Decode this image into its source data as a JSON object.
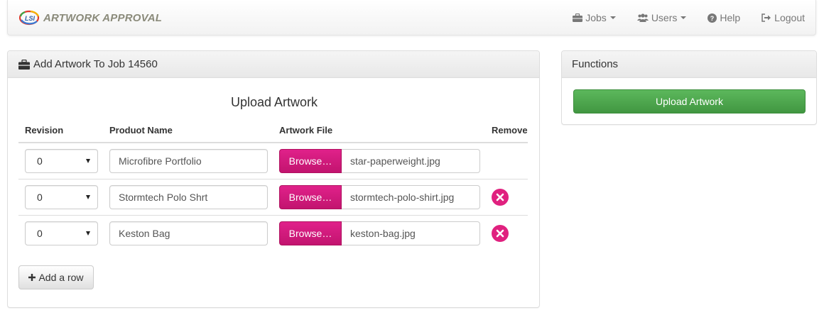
{
  "brand": {
    "name": "ARTWORK APPROVAL",
    "logo_icon": "lsi-logo-icon"
  },
  "nav": {
    "jobs": "Jobs",
    "users": "Users",
    "help": "Help",
    "logout": "Logout"
  },
  "main_panel": {
    "heading": "Add Artwork To Job 14560",
    "heading_icon": "briefcase-icon",
    "upload_title": "Upload Artwork",
    "columns": {
      "revision": "Revision",
      "product_name": "Produot Name",
      "artwork_file": "Artwork File",
      "remove": "Remove"
    },
    "rows": [
      {
        "revision": "0",
        "product_name": "Microfibre Portfolio",
        "browse_label": "Browse…",
        "file": "star-paperweight.jpg",
        "removable": false
      },
      {
        "revision": "0",
        "product_name": "Stormtech Polo Shrt",
        "browse_label": "Browse…",
        "file": "stormtech-polo-shirt.jpg",
        "removable": true
      },
      {
        "revision": "0",
        "product_name": "Keston Bag",
        "browse_label": "Browse…",
        "file": "keston-bag.jpg",
        "removable": true
      }
    ],
    "add_row_label": "Add a row"
  },
  "functions_panel": {
    "heading": "Functions",
    "upload_button": "Upload Artwork"
  },
  "colors": {
    "accent_magenta": "#e0217f",
    "success_green": "#5cb85c"
  }
}
